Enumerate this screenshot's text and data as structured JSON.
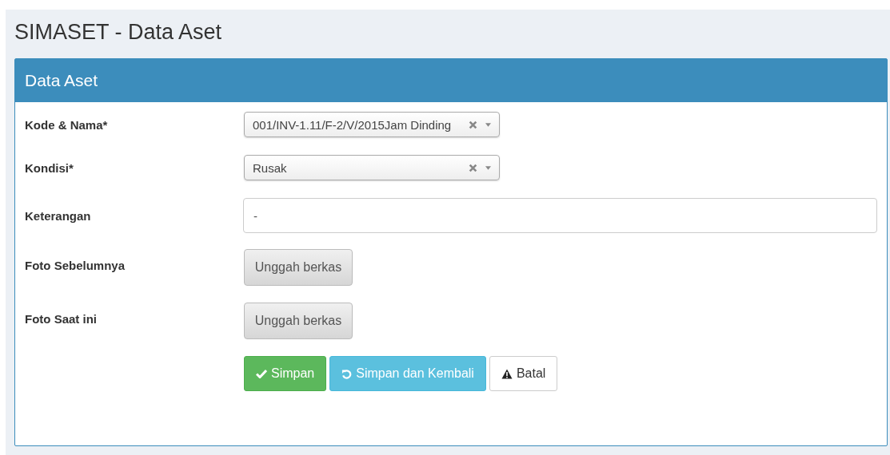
{
  "page_title": "SIMASET - Data Aset",
  "panel": {
    "title": "Data Aset"
  },
  "fields": [
    {
      "label": "Kode & Nama*",
      "kind": "select",
      "value": "001/INV-1.11/F-2/V/2015Jam Dinding"
    },
    {
      "label": "Kondisi*",
      "kind": "select",
      "value": "Rusak"
    },
    {
      "label": "Keterangan",
      "kind": "text",
      "value": "-"
    },
    {
      "label": "Foto Sebelumnya",
      "kind": "file",
      "button": "Unggah berkas"
    },
    {
      "label": "Foto Saat ini",
      "kind": "file",
      "button": "Unggah berkas"
    }
  ],
  "actions": [
    {
      "label": "Simpan",
      "kind": "success"
    },
    {
      "label": "Simpan dan Kembali",
      "kind": "info"
    },
    {
      "label": "Batal",
      "kind": "default"
    }
  ]
}
